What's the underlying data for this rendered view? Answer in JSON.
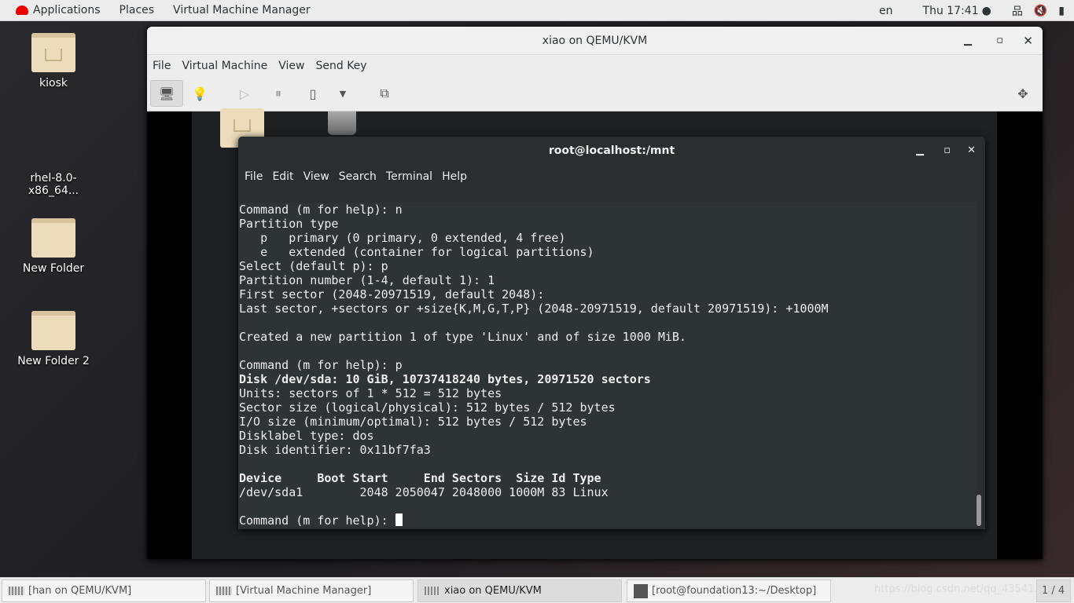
{
  "topbar": {
    "applications": "Applications",
    "places": "Places",
    "app": "Virtual Machine Manager",
    "lang": "en",
    "clock": "Thu 17:41",
    "icons": [
      "network-icon",
      "volume-muted-icon",
      "battery-icon"
    ]
  },
  "desktop": {
    "icons": [
      {
        "label": "kiosk"
      },
      {
        "label": "rhel-8.0-x86_64..."
      },
      {
        "label": "New Folder"
      },
      {
        "label": "New Folder 2"
      }
    ]
  },
  "vm": {
    "title": "xiao on QEMU/KVM",
    "menu": [
      "File",
      "Virtual Machine",
      "View",
      "Send Key"
    ]
  },
  "terminal": {
    "title": "root@localhost:/mnt",
    "menu": [
      "File",
      "Edit",
      "View",
      "Search",
      "Terminal",
      "Help"
    ],
    "lines": [
      {
        "t": "Command (m for help): n"
      },
      {
        "t": "Partition type"
      },
      {
        "t": "   p   primary (0 primary, 0 extended, 4 free)"
      },
      {
        "t": "   e   extended (container for logical partitions)"
      },
      {
        "t": "Select (default p): p"
      },
      {
        "t": "Partition number (1-4, default 1): 1"
      },
      {
        "t": "First sector (2048-20971519, default 2048):"
      },
      {
        "t": "Last sector, +sectors or +size{K,M,G,T,P} (2048-20971519, default 20971519): +1000M"
      },
      {
        "t": ""
      },
      {
        "t": "Created a new partition 1 of type 'Linux' and of size 1000 MiB."
      },
      {
        "t": ""
      },
      {
        "t": "Command (m for help): p"
      },
      {
        "t": "Disk /dev/sda: 10 GiB, 10737418240 bytes, 20971520 sectors",
        "bold": true
      },
      {
        "t": "Units: sectors of 1 * 512 = 512 bytes"
      },
      {
        "t": "Sector size (logical/physical): 512 bytes / 512 bytes"
      },
      {
        "t": "I/O size (minimum/optimal): 512 bytes / 512 bytes"
      },
      {
        "t": "Disklabel type: dos"
      },
      {
        "t": "Disk identifier: 0x11bf7fa3"
      },
      {
        "t": ""
      },
      {
        "t": "Device     Boot Start     End Sectors  Size Id Type",
        "bold": true
      },
      {
        "t": "/dev/sda1        2048 2050047 2048000 1000M 83 Linux"
      },
      {
        "t": ""
      }
    ],
    "prompt": "Command (m for help): "
  },
  "taskbar": {
    "tasks": [
      "[han on QEMU/KVM]",
      "[Virtual Machine Manager]",
      "xiao on QEMU/KVM",
      "[root@foundation13:~/Desktop]"
    ],
    "workspace": "1 / 4",
    "watermark": "https://blog.csdn.net/qq_43541..."
  }
}
